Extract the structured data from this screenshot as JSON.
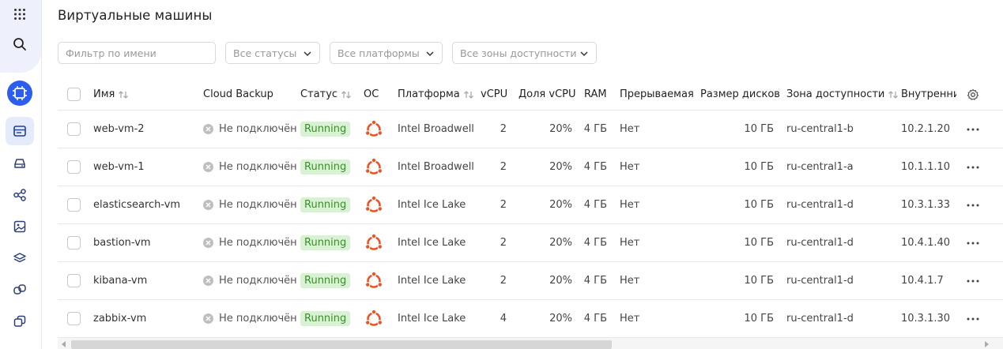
{
  "page": {
    "title": "Виртуальные машины"
  },
  "sidebar": {
    "items": [
      {
        "name": "apps-grid-icon"
      },
      {
        "name": "search-icon"
      },
      {
        "name": "compute-service-icon"
      },
      {
        "name": "vm-list-icon"
      },
      {
        "name": "disks-icon"
      },
      {
        "name": "placement-groups-icon"
      },
      {
        "name": "images-icon"
      },
      {
        "name": "snapshots-icon"
      },
      {
        "name": "instance-groups-icon"
      },
      {
        "name": "copy-icon"
      }
    ]
  },
  "filters": {
    "name_placeholder": "Фильтр по имени",
    "status": "Все статусы",
    "platform": "Все платформы",
    "zone": "Все зоны доступности"
  },
  "columns": {
    "name": "Имя",
    "backup": "Cloud Backup",
    "status": "Статус",
    "os": "ОС",
    "platform": "Платформа",
    "vcpu": "vCPU",
    "vcpu_share": "Доля vCPU",
    "ram": "RAM",
    "preemptible": "Прерываемая",
    "disk_size": "Размер дисков",
    "zone": "Зона доступности",
    "internal": "Внутренни"
  },
  "rows": [
    {
      "name": "web-vm-2",
      "backup": "Не подключён",
      "status": "Running",
      "os": "ubuntu",
      "platform": "Intel Broadwell",
      "vcpu": "2",
      "vcpu_share": "20%",
      "ram": "4 ГБ",
      "preemptible": "Нет",
      "disk_size": "10 ГБ",
      "zone": "ru-central1-b",
      "ip": "10.2.1.20"
    },
    {
      "name": "web-vm-1",
      "backup": "Не подключён",
      "status": "Running",
      "os": "ubuntu",
      "platform": "Intel Broadwell",
      "vcpu": "2",
      "vcpu_share": "20%",
      "ram": "4 ГБ",
      "preemptible": "Нет",
      "disk_size": "10 ГБ",
      "zone": "ru-central1-a",
      "ip": "10.1.1.10"
    },
    {
      "name": "elasticsearch-vm",
      "backup": "Не подключён",
      "status": "Running",
      "os": "ubuntu",
      "platform": "Intel Ice Lake",
      "vcpu": "2",
      "vcpu_share": "20%",
      "ram": "4 ГБ",
      "preemptible": "Нет",
      "disk_size": "10 ГБ",
      "zone": "ru-central1-d",
      "ip": "10.3.1.33"
    },
    {
      "name": "bastion-vm",
      "backup": "Не подключён",
      "status": "Running",
      "os": "ubuntu",
      "platform": "Intel Ice Lake",
      "vcpu": "2",
      "vcpu_share": "20%",
      "ram": "4 ГБ",
      "preemptible": "Нет",
      "disk_size": "10 ГБ",
      "zone": "ru-central1-d",
      "ip": "10.4.1.40"
    },
    {
      "name": "kibana-vm",
      "backup": "Не подключён",
      "status": "Running",
      "os": "ubuntu",
      "platform": "Intel Ice Lake",
      "vcpu": "2",
      "vcpu_share": "20%",
      "ram": "4 ГБ",
      "preemptible": "Нет",
      "disk_size": "10 ГБ",
      "zone": "ru-central1-d",
      "ip": "10.4.1.7"
    },
    {
      "name": "zabbix-vm",
      "backup": "Не подключён",
      "status": "Running",
      "os": "ubuntu",
      "platform": "Intel Ice Lake",
      "vcpu": "4",
      "vcpu_share": "20%",
      "ram": "4 ГБ",
      "preemptible": "Нет",
      "disk_size": "10 ГБ",
      "zone": "ru-central1-d",
      "ip": "10.3.1.30"
    }
  ],
  "colors": {
    "accent": "#2a5df0",
    "status_bg": "#d9f2d3",
    "status_text": "#3b8f2b",
    "ubuntu": "#e95420"
  }
}
